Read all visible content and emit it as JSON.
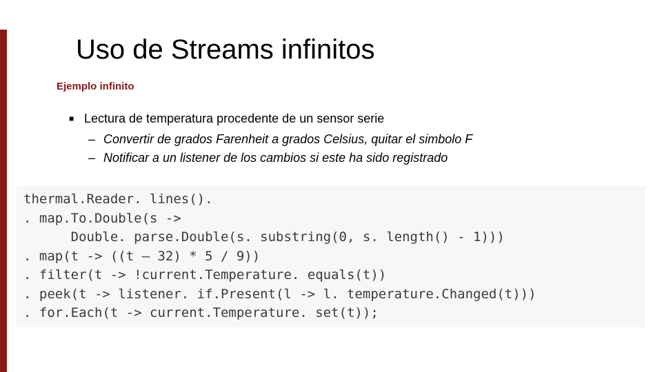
{
  "slide": {
    "title": "Uso de Streams infinitos",
    "subtitle": "Ejemplo infinito",
    "bullet": "Lectura de temperatura procedente de un sensor serie",
    "sub_bullets": [
      "Convertir de grados Farenheit a grados Celsius, quitar el simbolo F",
      "Notificar a un listener de los cambios si este ha sido registrado"
    ],
    "code": "thermal.Reader. lines().\n. map.To.Double(s ->\n      Double. parse.Double(s. substring(0, s. length() - 1)))\n. map(t -> ((t – 32) * 5 / 9))\n. filter(t -> !current.Temperature. equals(t))\n. peek(t -> listener. if.Present(l -> l. temperature.Changed(t)))\n. for.Each(t -> current.Temperature. set(t));"
  }
}
